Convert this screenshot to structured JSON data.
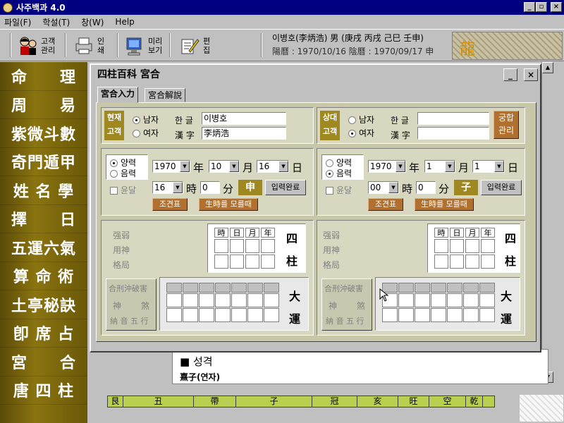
{
  "window": {
    "title": "사주백과 4.0"
  },
  "menu": [
    "파일(F)",
    "학설(T)",
    "창(W)",
    "Help"
  ],
  "toolbar": {
    "customer": [
      "고객",
      "관리"
    ],
    "print": [
      "인",
      "쇄"
    ],
    "preview": [
      "미리",
      "보기"
    ],
    "edit": [
      "편",
      "집"
    ]
  },
  "person": {
    "line1": "이병호(李炳浩) 男 (庚戌 丙戌 己巳 壬申)",
    "line2": "陽曆 : 1970/10/16  陰曆 : 1970/09/17  申"
  },
  "sidebar": [
    {
      "text": "命　理",
      "two": true
    },
    {
      "text": "周　易",
      "two": true
    },
    {
      "text": "紫微斗數"
    },
    {
      "text": "奇門遁甲"
    },
    {
      "text": "姓 名 學"
    },
    {
      "text": "擇　日",
      "two": true
    },
    {
      "text": "五運六氣"
    },
    {
      "text": "算 命 術"
    },
    {
      "text": "土亭秘訣"
    },
    {
      "text": "卽 席 占"
    },
    {
      "text": "宮　合",
      "two": true
    },
    {
      "text": "唐 四 柱"
    }
  ],
  "dialog": {
    "title": "四柱百科 宮合",
    "tabs": [
      "宮合入力",
      "宮合解說"
    ]
  },
  "left": {
    "badge": [
      "현재",
      "고객"
    ],
    "male": "남자",
    "female": "여자",
    "hangul_label": "한  글",
    "hanja_label": "漢  字",
    "hangul": "이병호",
    "hanja": "李炳浩",
    "solar": "양력",
    "lunar": "음력",
    "year": "1970",
    "month": "10",
    "day": "16",
    "leap": "윤달",
    "hour": "16",
    "minute": "0",
    "branch": "申",
    "confirm": "입력완료",
    "cond": "조견표",
    "unknown_time": "生時를 모를때"
  },
  "right": {
    "badge": [
      "상대",
      "고객"
    ],
    "male": "남자",
    "female": "여자",
    "hangul_label": "한  글",
    "hanja_label": "漢  字",
    "hangul": "",
    "hanja": "",
    "solar": "양력",
    "lunar": "음력",
    "year": "1970",
    "month": "1",
    "day": "1",
    "leap": "윤달",
    "hour": "00",
    "minute": "0",
    "branch": "子",
    "confirm": "입력완료",
    "cond": "조견표",
    "unknown_time": "生時를 모를때",
    "compat": [
      "궁합",
      "관리"
    ]
  },
  "units": {
    "year": "年",
    "month": "月",
    "day": "日",
    "hour": "時",
    "minute": "分"
  },
  "analysis": {
    "strength": "强弱",
    "useful": "用神",
    "pattern": "格局",
    "pillar_headers": [
      "時",
      "日",
      "月",
      "年"
    ],
    "four": "四",
    "pillar": "柱",
    "clash_btn": "合刑沖破害",
    "shensha_1": "神",
    "shensha_2": "煞",
    "nayin": "納 音 五 行",
    "great": "大",
    "luck": "運"
  },
  "background": {
    "doc_row1": "■ 성격",
    "doc_row2": "熹子(연자)",
    "stem_row": [
      "艮",
      "丑",
      "帶",
      "子",
      "冠",
      "亥",
      "旺",
      "空",
      "乾"
    ]
  }
}
